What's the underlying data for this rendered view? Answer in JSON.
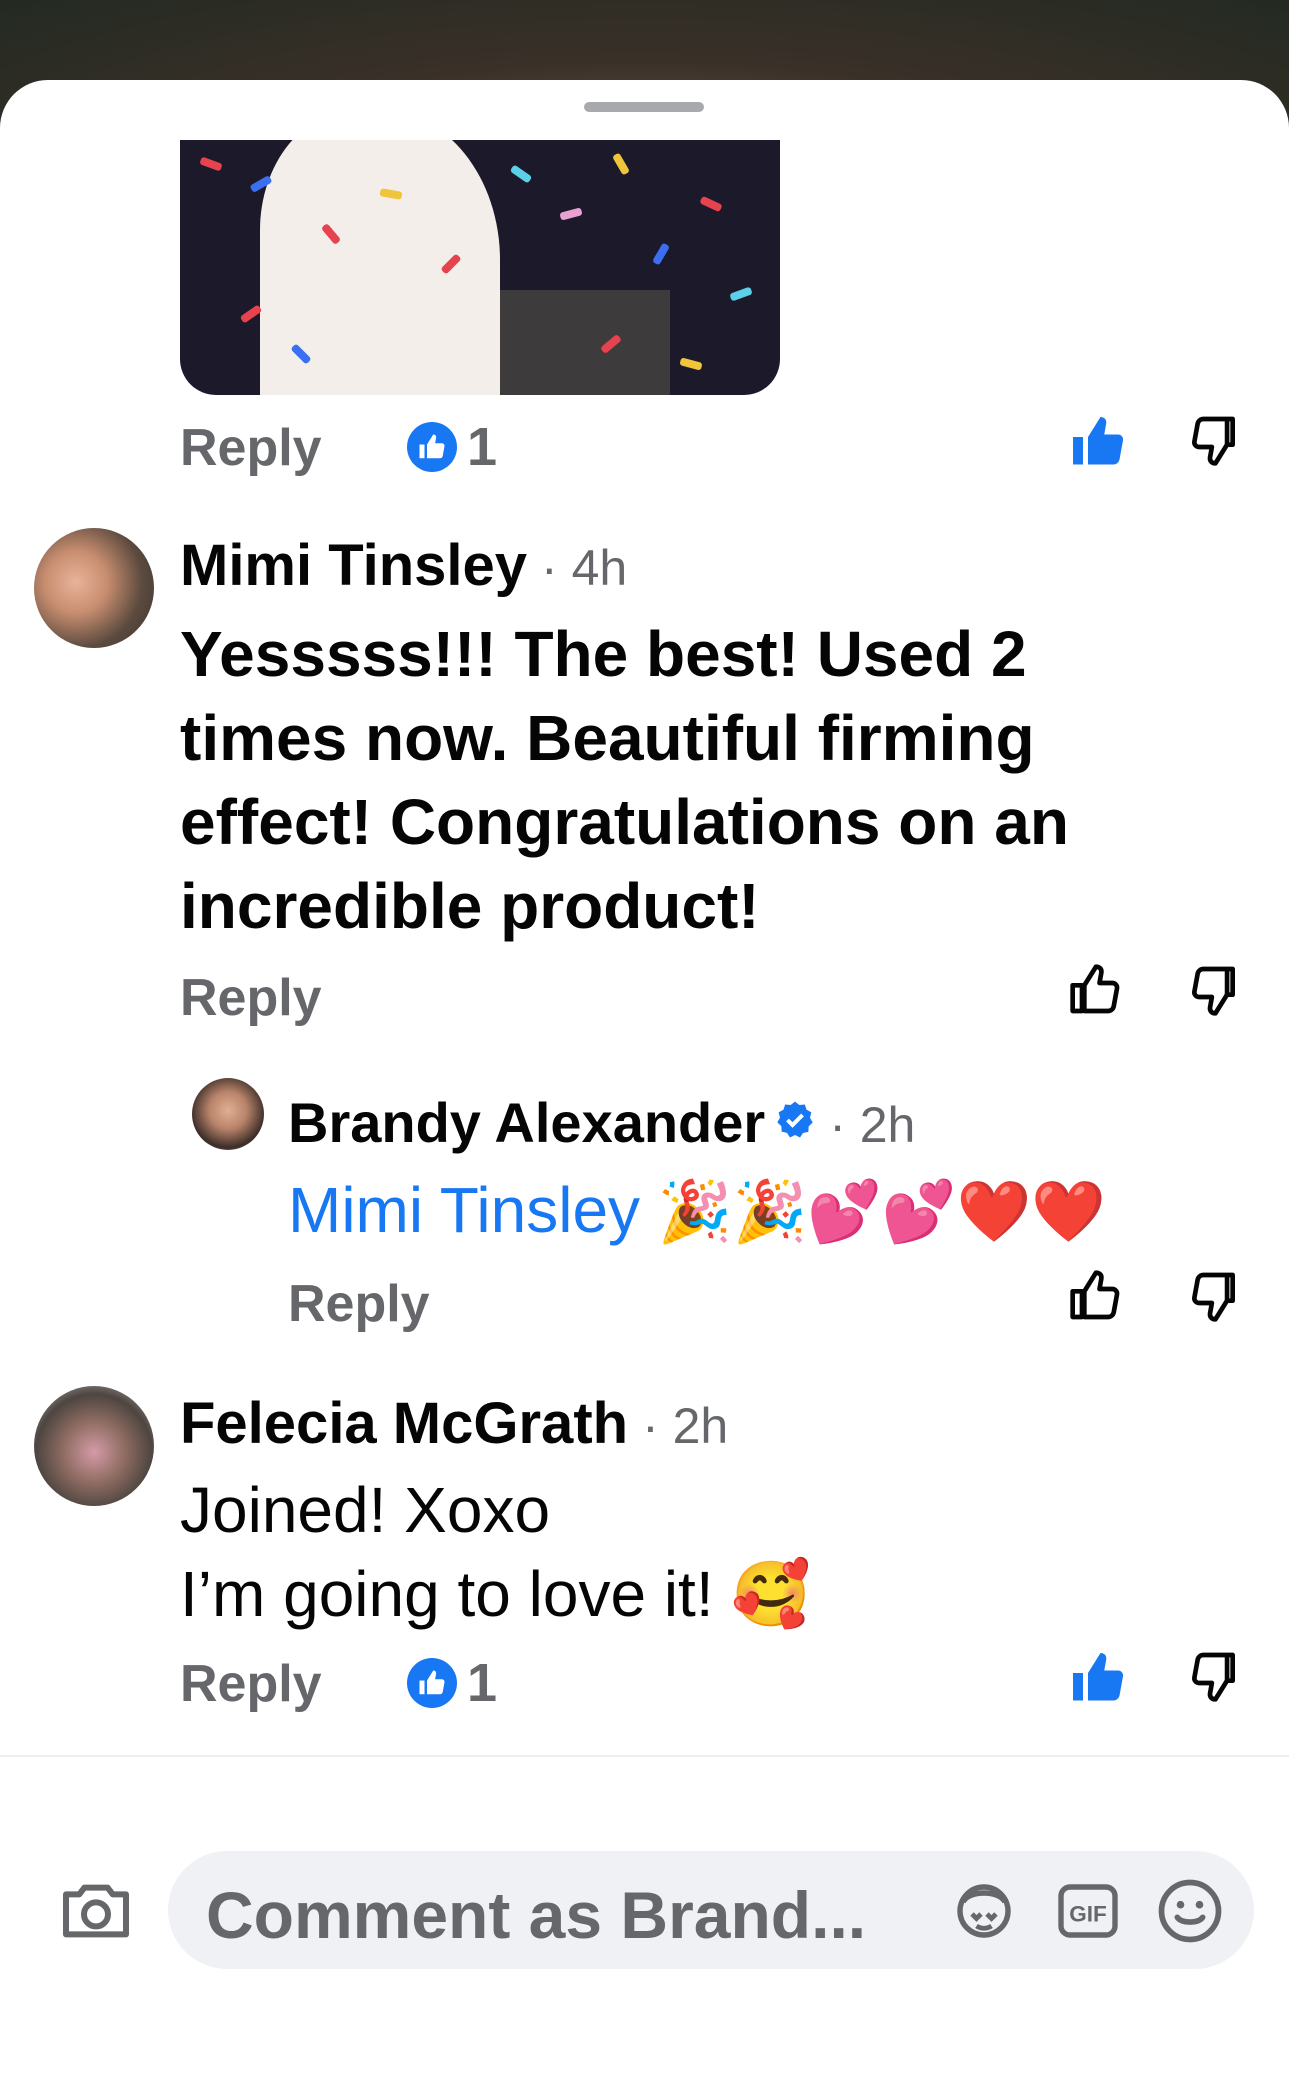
{
  "thread": {
    "first_reply_label": "Reply",
    "first_like_count": "1",
    "comments": [
      {
        "author": "Mimi Tinsley",
        "time": "· 4h",
        "lines": [
          "Yesssss!!! The best! Used 2",
          "times now. Beautiful firming",
          "effect! Congratulations on an",
          "incredible product!"
        ],
        "reply_label": "Reply"
      },
      {
        "author": "Brandy Alexander",
        "time": "· 2h",
        "mention": "Mimi Tinsley",
        "emojis": "🎉🎉💕💕❤️❤️",
        "reply_label": "Reply"
      },
      {
        "author": "Felecia McGrath",
        "time": "· 2h",
        "lines": [
          "Joined! Xoxo",
          "I’m going to love it! 🥰"
        ],
        "reply_label": "Reply",
        "like_count": "1"
      }
    ]
  },
  "composer": {
    "placeholder": "Comment as Brand...",
    "icons": [
      "camera-icon",
      "avatar-sticker-icon",
      "gif-icon",
      "emoji-icon"
    ]
  },
  "colors": {
    "accent": "#1877f2",
    "secondary_text": "#65676b",
    "primary_text": "#050505"
  }
}
